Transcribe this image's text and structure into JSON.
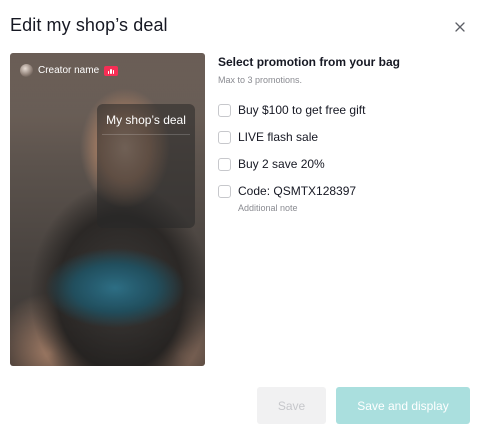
{
  "dialog": {
    "title": "Edit my shop’s deal",
    "close_icon": "close-icon"
  },
  "preview": {
    "creator_name": "Creator name",
    "live_badge_icon": "live-bars-icon",
    "deal_title": "My shop’s deal"
  },
  "promotions": {
    "title": "Select promotion from your bag",
    "subtitle": "Max to 3 promotions.",
    "options": [
      {
        "label": "Buy $100 to get free gift",
        "checked": false
      },
      {
        "label": "LIVE flash sale",
        "checked": false
      },
      {
        "label": "Buy 2 save 20%",
        "checked": false
      },
      {
        "label": "Code: QSMTX128397",
        "note": "Additional note",
        "checked": false
      }
    ]
  },
  "actions": {
    "save_label": "Save",
    "save_display_label": "Save and display"
  },
  "colors": {
    "live_badge": "#fe2c55",
    "primary_disabled": "#aadfde",
    "secondary_disabled": "#f1f1f2"
  }
}
